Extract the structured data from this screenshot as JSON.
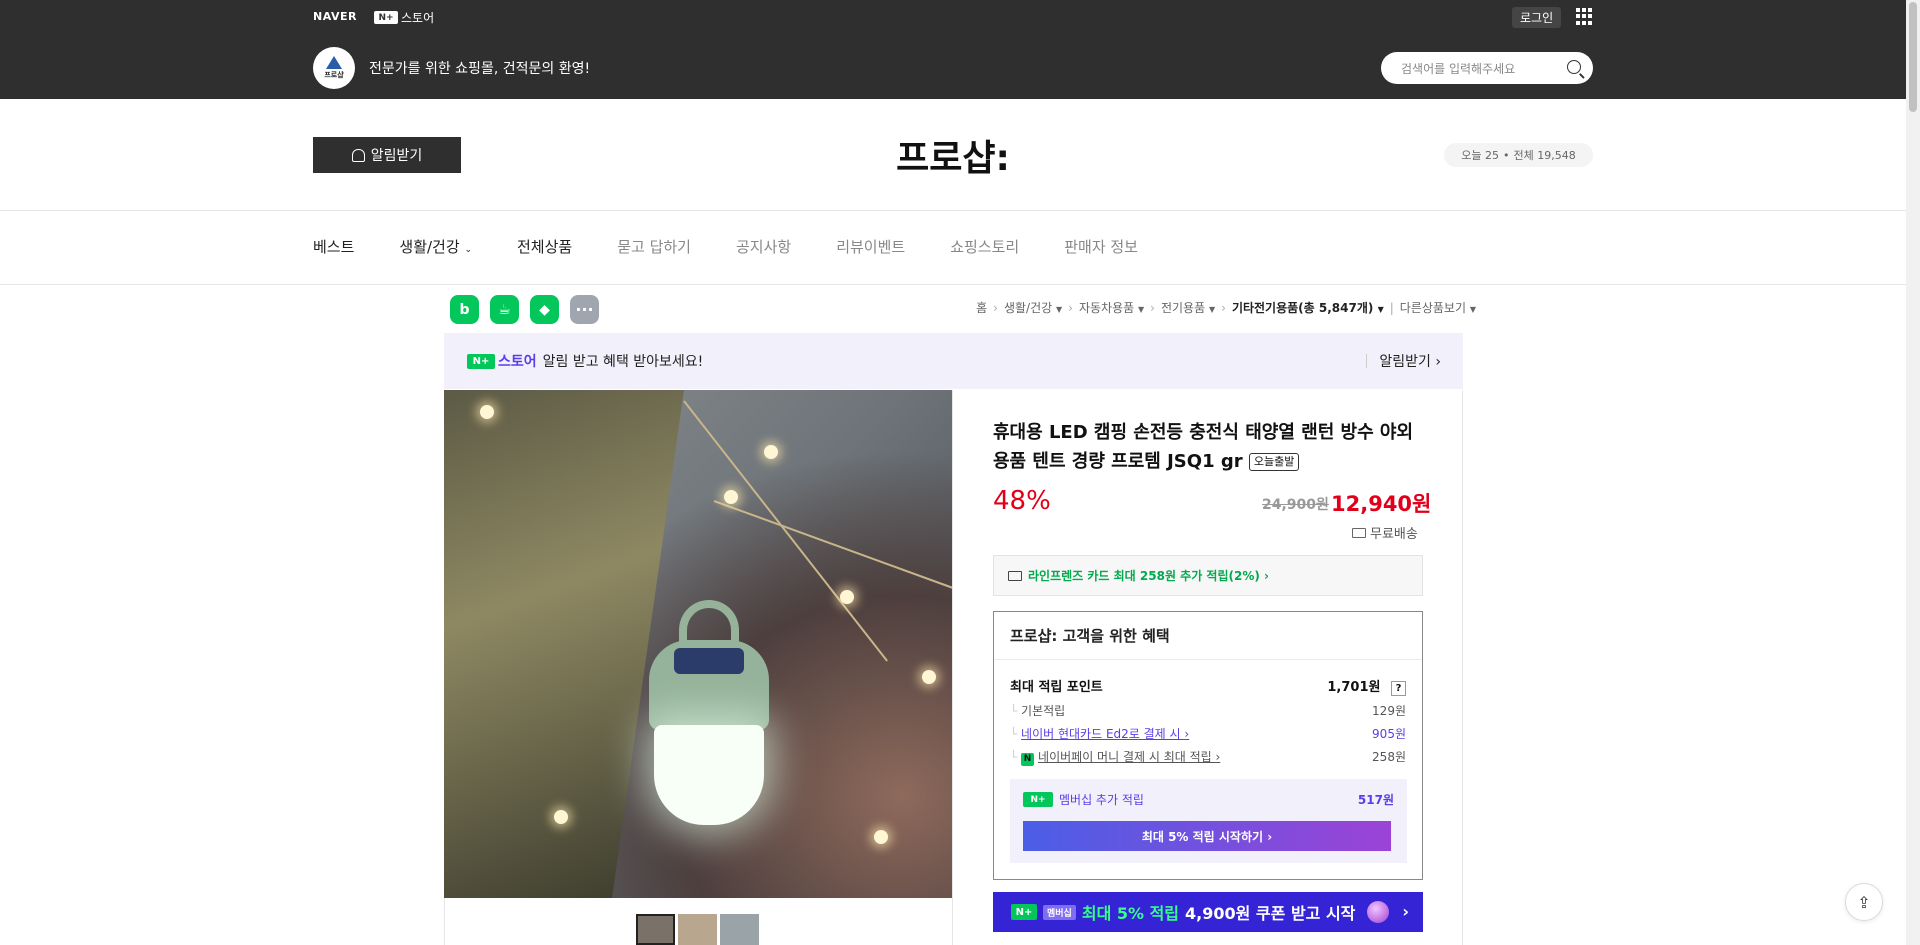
{
  "topbar": {
    "naver": "NAVER",
    "store_badge": "N+",
    "store_label": "스토어",
    "login": "로그인",
    "logo_text": "프로샵",
    "tagline": "전문가를 위한 쇼핑몰, 건적문의 환영!",
    "search_placeholder": "검색어를 입력해주세요"
  },
  "header": {
    "alarm_button": "알림받기",
    "store_title": "프로샵:",
    "visits_today": "오늘 25",
    "visits_dot": "•",
    "visits_total": "전체 19,548"
  },
  "nav": {
    "items": [
      "베스트",
      "생활/건강",
      "전체상품",
      "묻고 답하기",
      "공지사항",
      "리뷰이벤트",
      "쇼핑스토리",
      "판매자 정보"
    ]
  },
  "share_icons": {
    "blog": "b",
    "cafe": "☕",
    "bookmark": "◆",
    "more": "···"
  },
  "breadcrumb": {
    "home": "홈",
    "items": [
      "생활/건강",
      "자동차용품",
      "전기용품"
    ],
    "current": "기타전기용품(총 5,847개)",
    "other": "다른상품보기"
  },
  "notice": {
    "badge": "N+",
    "store": "스토어",
    "message": "알림 받고 혜택 받아보세요!",
    "action": "알림받기 ›"
  },
  "product": {
    "title": "휴대용 LED 캠핑 손전등 충전식 태양열 랜턴 방수 야외 용품 텐트 경량 프로템 JSQ1 gr",
    "today_ship_tag": "오늘출발",
    "discount": "48%",
    "original_price": "24,900원",
    "sale_price": "12,940원",
    "shipping": "무료배송",
    "card_benefit": "라인프렌즈 카드 최대 258원 추가 적립(2%) ›"
  },
  "benefit": {
    "header": "프로샵: 고객을 위한 혜택",
    "max_points_label": "최대 적립 포인트",
    "max_points_value": "1,701원",
    "help": "?",
    "basic_label": "기본적립",
    "basic_value": "129원",
    "card_label": "네이버 현대카드 Ed2로 결제 시 ›",
    "card_value": "905원",
    "npay_icon": "N",
    "npay_label": "네이버페이 머니 결제 시 최대 적립 ›",
    "npay_value": "258원",
    "member_badge": "N+",
    "member_label": "멤버십 추가 적립",
    "member_value": "517원",
    "member_button": "최대 5% 적립 시작하기 ›"
  },
  "promo": {
    "badge": "N+",
    "membership": "멤버십",
    "highlight": "최대 5% 적립",
    "text": "4,900원 쿠폰 받고 시작",
    "arrow": "›"
  },
  "floating": {
    "share": "⇪"
  }
}
